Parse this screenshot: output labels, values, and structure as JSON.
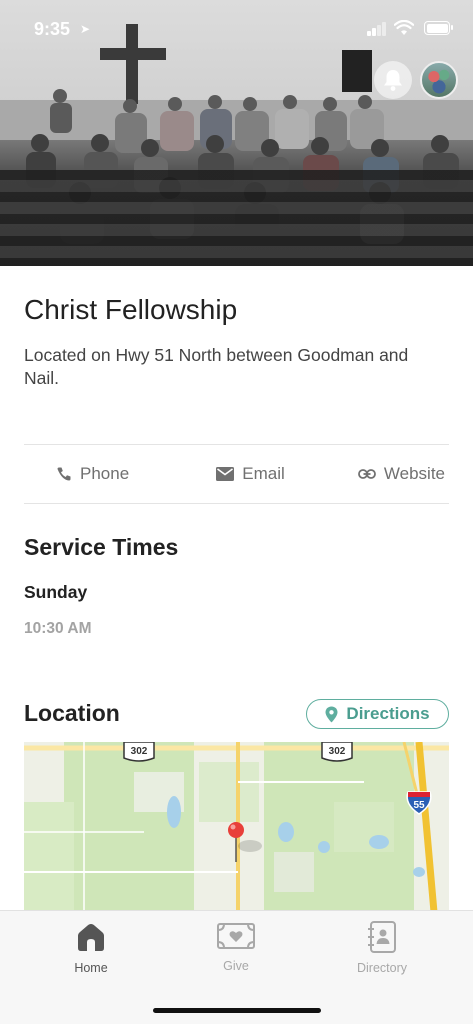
{
  "status_bar": {
    "time": "9:35"
  },
  "hero": {
    "image": "church-congregation-photo"
  },
  "church": {
    "name": "Christ Fellowship",
    "description": "Located on Hwy 51 North between Goodman and Nail."
  },
  "contact": {
    "phone_label": "Phone",
    "email_label": "Email",
    "website_label": "Website"
  },
  "service_times": {
    "heading": "Service Times",
    "day": "Sunday",
    "time": "10:30 AM"
  },
  "location": {
    "heading": "Location",
    "directions_label": "Directions",
    "map": {
      "route_badge_1": "302",
      "route_badge_2": "302",
      "interstate": "55"
    }
  },
  "tabbar": {
    "tabs": [
      {
        "label": "Home",
        "icon": "home-icon",
        "active": true
      },
      {
        "label": "Give",
        "icon": "give-icon",
        "active": false
      },
      {
        "label": "Directory",
        "icon": "directory-icon",
        "active": false
      }
    ]
  },
  "colors": {
    "accent": "#4a9d8f",
    "text": "#222222",
    "muted": "#a3a3a3"
  }
}
